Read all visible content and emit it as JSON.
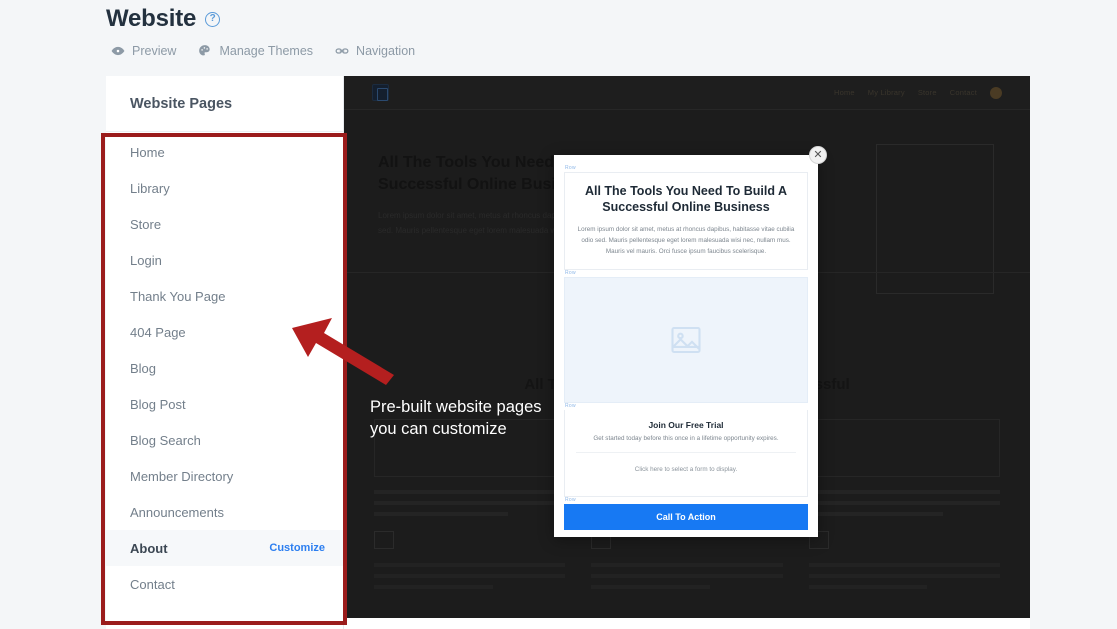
{
  "header": {
    "title": "Website",
    "help_icon": "question-circle-icon",
    "actions": [
      {
        "label": "Preview",
        "icon": "eye-icon"
      },
      {
        "label": "Manage Themes",
        "icon": "palette-icon"
      },
      {
        "label": "Navigation",
        "icon": "link-icon"
      }
    ]
  },
  "sidebar": {
    "heading": "Website Pages",
    "customize_label": "Customize",
    "items": [
      {
        "label": "Home",
        "active": false
      },
      {
        "label": "Library",
        "active": false
      },
      {
        "label": "Store",
        "active": false
      },
      {
        "label": "Login",
        "active": false
      },
      {
        "label": "Thank You Page",
        "active": false
      },
      {
        "label": "404 Page",
        "active": false
      },
      {
        "label": "Blog",
        "active": false
      },
      {
        "label": "Blog Post",
        "active": false
      },
      {
        "label": "Blog Search",
        "active": false
      },
      {
        "label": "Member Directory",
        "active": false
      },
      {
        "label": "Announcements",
        "active": false
      },
      {
        "label": "About",
        "active": true
      },
      {
        "label": "Contact",
        "active": false
      }
    ]
  },
  "preview": {
    "logo": "brand-logo-icon",
    "nav_links": [
      "Home",
      "My Library",
      "Store",
      "Contact"
    ],
    "avatar": "user-avatar",
    "hero_title": "All The Tools You Need To Build A Successful Online Business",
    "hero_paragraph": "Lorem ipsum dolor sit amet, metus at rhoncus dapibus, habitasse vitae cubilia odio sed. Mauris pellentesque eget lorem malesuada wisi nec, nullam mus.",
    "lower_title": "All The Tools You Need To Build A Successful"
  },
  "modal": {
    "close_icon": "close-icon",
    "row_tag": "Row",
    "headline": "All The Tools You Need To Build A Successful Online Business",
    "paragraph": "Lorem ipsum dolor sit amet, metus at rhoncus dapibus, habitasse vitae cubilia odio sed. Mauris pellentesque eget lorem malesuada wisi nec, nullam mus. Mauris vel mauris. Orci fusce ipsum faucibus scelerisque.",
    "image_placeholder_icon": "image-placeholder-icon",
    "subhead": "Join Our Free Trial",
    "subtext": "Get started today before this once in a lifetime opportunity expires.",
    "form_note": "Click here to select a form to display.",
    "cta_label": "Call To Action"
  },
  "annotation": {
    "callout_text": "Pre-built website pages you can customize",
    "arrow": "red-arrow-pointing-left",
    "highlight_box": "red-highlight-box"
  },
  "colors": {
    "accent_blue": "#2d7ff0",
    "cta_blue": "#1779f3",
    "annotation_red": "#9b1c1c",
    "dark_preview": "#1c1c1c",
    "page_bg": "#f4f6f8"
  }
}
